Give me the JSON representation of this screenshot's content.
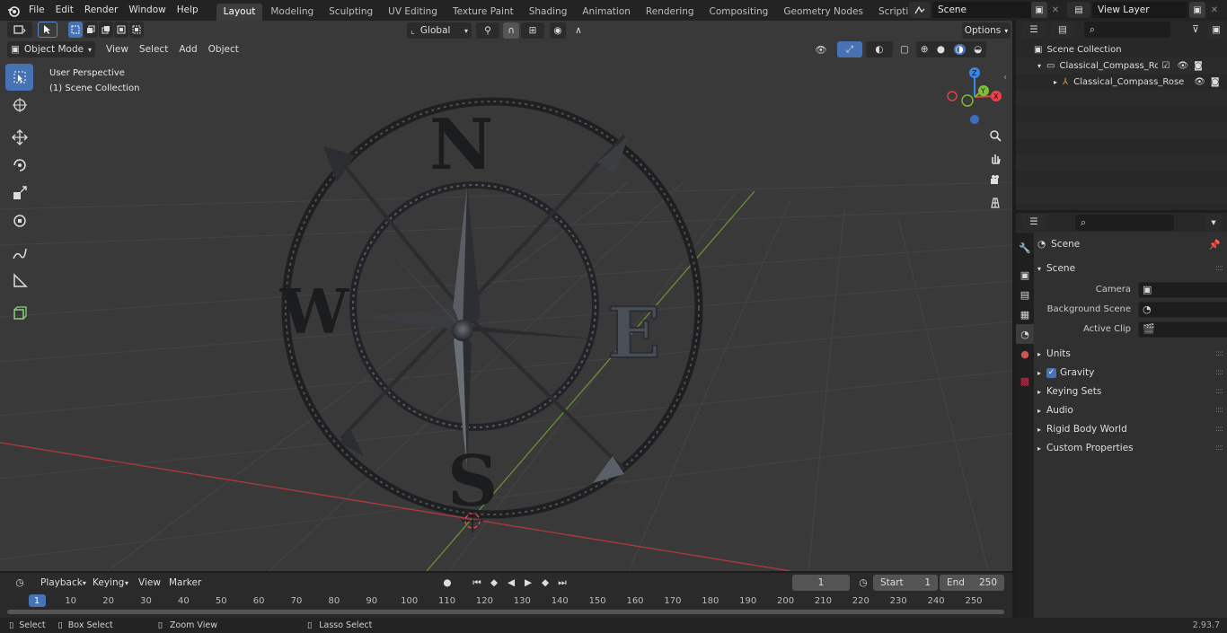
{
  "menu": [
    "File",
    "Edit",
    "Render",
    "Window",
    "Help"
  ],
  "workspaces": [
    "Layout",
    "Modeling",
    "Sculpting",
    "UV Editing",
    "Texture Paint",
    "Shading",
    "Animation",
    "Rendering",
    "Compositing",
    "Geometry Nodes",
    "Scripting"
  ],
  "active_workspace": "Layout",
  "scene_name": "Scene",
  "view_layer": "View Layer",
  "viewport": {
    "mode": "Object Mode",
    "menus": [
      "View",
      "Select",
      "Add",
      "Object"
    ],
    "transform_orientation": "Global",
    "options_label": "Options",
    "view_label": "User Perspective",
    "collection_label": "(1) Scene Collection",
    "compass_letters": [
      "N",
      "S",
      "W",
      "E"
    ],
    "gizmo_axes": [
      "X",
      "Y",
      "Z"
    ]
  },
  "outliner": {
    "root": "Scene Collection",
    "items": [
      {
        "label": "Classical_Compass_Rose_Gol"
      },
      {
        "label": "Classical_Compass_Rose"
      }
    ]
  },
  "properties": {
    "context_title": "Scene",
    "panel_title": "Scene",
    "fields": [
      {
        "label": "Camera"
      },
      {
        "label": "Background Scene"
      },
      {
        "label": "Active Clip"
      }
    ],
    "subpanels": [
      "Units",
      "Gravity",
      "Keying Sets",
      "Audio",
      "Rigid Body World",
      "Custom Properties"
    ]
  },
  "timeline": {
    "menus": [
      "Playback",
      "Keying",
      "View",
      "Marker"
    ],
    "current_frame": "1",
    "start_label": "Start",
    "start_value": "1",
    "end_label": "End",
    "end_value": "250",
    "ruler_marks": [
      "1",
      "10",
      "20",
      "30",
      "40",
      "50",
      "60",
      "70",
      "80",
      "90",
      "100",
      "110",
      "120",
      "130",
      "140",
      "150",
      "160",
      "170",
      "180",
      "190",
      "200",
      "210",
      "220",
      "230",
      "240",
      "250"
    ]
  },
  "statusbar": {
    "select": "Select",
    "box_select": "Box Select",
    "zoom_view": "Zoom View",
    "lasso_select": "Lasso Select",
    "version": "2.93.7"
  },
  "colors": {
    "accent": "#4772b3",
    "x_axis": "#e8424b",
    "y_axis": "#7fbf34",
    "z_axis": "#3a86e5"
  }
}
